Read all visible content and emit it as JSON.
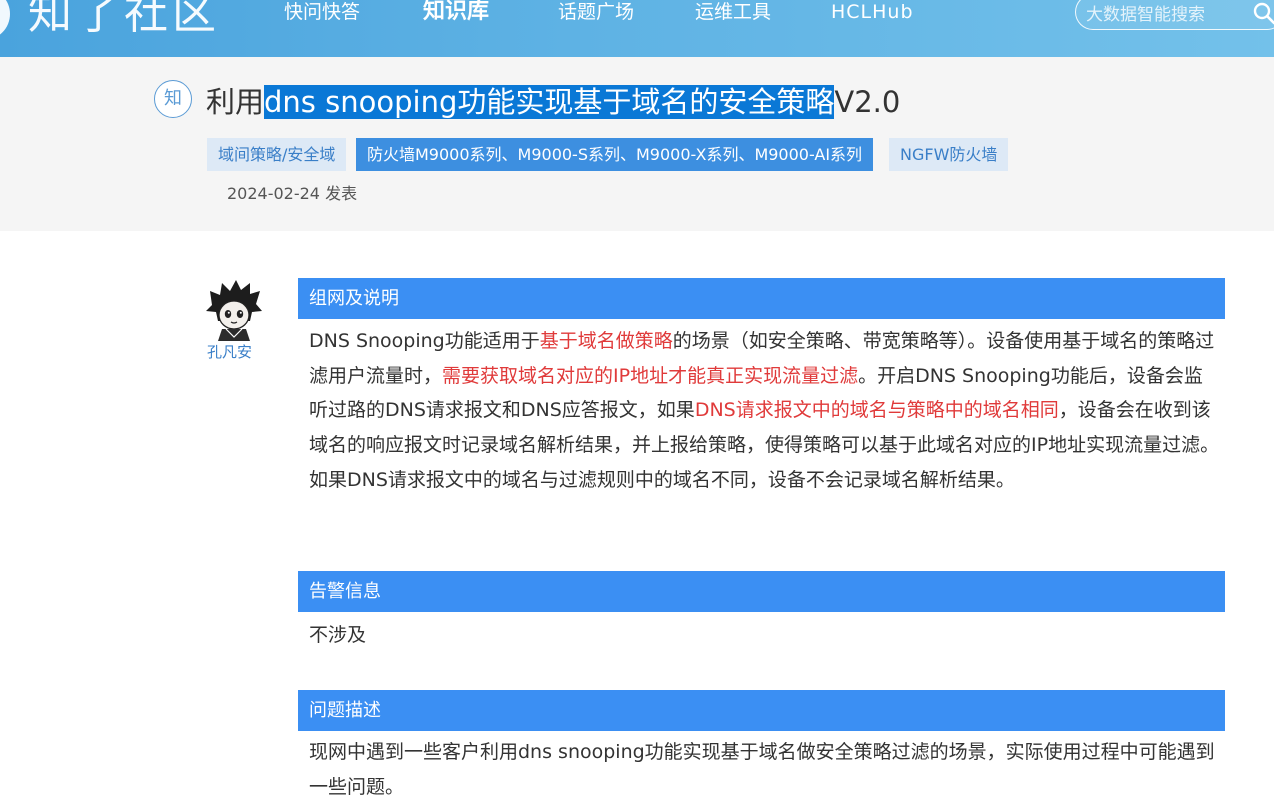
{
  "nav": {
    "logo_text": "知了社区",
    "items": [
      "快问快答",
      "知识库",
      "话题广场",
      "运维工具",
      "HCLHub"
    ],
    "search_placeholder": "大数据智能搜索"
  },
  "article": {
    "badge": "知",
    "title_pre": "利用",
    "title_selected": "dns snooping功能实现基于域名的安全策略",
    "title_post": "V2.0",
    "tags": [
      "域间策略/安全域",
      "防火墙M9000系列、M9000-S系列、M9000-X系列、M9000-AI系列",
      "NGFW防火墙"
    ],
    "date": "2024-02-24 发表"
  },
  "author": {
    "name": "孔凡安"
  },
  "sections": [
    {
      "heading": "组网及说明",
      "parts": [
        "DNS Snooping功能适用于",
        "基于域名做策略",
        "的场景（如安全策略、带宽策略等）。设备使用基于域名的策略过滤用户流量时，",
        "需要获取域名对应的IP地址才能真正实现流量过滤",
        "。开启DNS Snooping功能后，设备会监听过路的DNS请求报文和DNS应答报文，如果",
        "DNS请求报文中的域名与策略中的域名相同",
        "，设备会在收到该域名的响应报文时记录域名解析结果，并上报给策略，使得策略可以基于此域名对应的IP地址实现流量过滤。如果DNS请求报文中的域名与过滤规则中的域名不同，设备不会记录域名解析结果。"
      ]
    },
    {
      "heading": "告警信息",
      "body": "不涉及"
    },
    {
      "heading": "问题描述",
      "body": "现网中遇到一些客户利用dns snooping功能实现基于域名做安全策略过滤的场景，实际使用过程中可能遇到一些问题。"
    }
  ],
  "colors": {
    "nav_blue": "#5eb2e4",
    "section_blue": "#3b8ff3",
    "highlight_red": "#e03a3a",
    "selection_blue": "#0a78d6"
  }
}
